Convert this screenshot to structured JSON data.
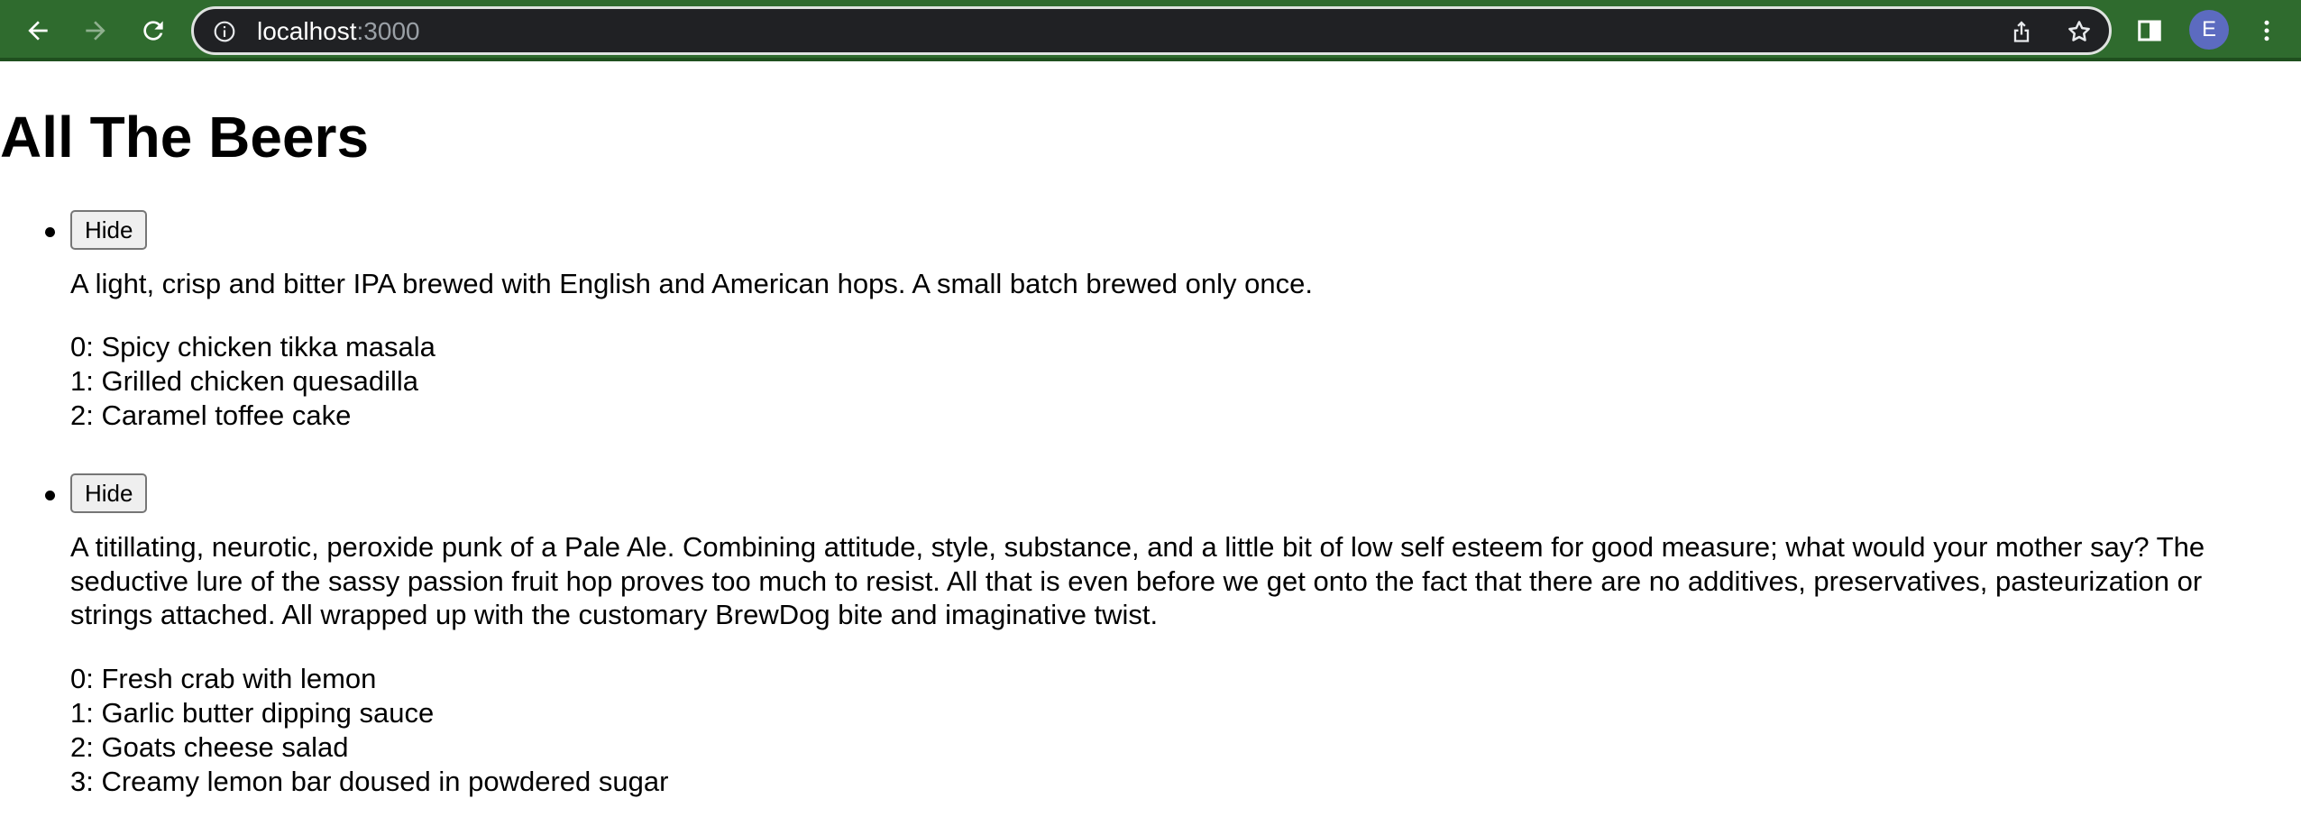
{
  "browser": {
    "url_host": "localhost",
    "url_port": ":3000",
    "profile_initial": "E"
  },
  "page": {
    "title": "All The Beers",
    "beers": [
      {
        "button_label": "Hide",
        "description": "A light, crisp and bitter IPA brewed with English and American hops. A small batch brewed only once.",
        "food_pairing": [
          "0: Spicy chicken tikka masala",
          "1: Grilled chicken quesadilla",
          "2: Caramel toffee cake"
        ]
      },
      {
        "button_label": "Hide",
        "description": "A titillating, neurotic, peroxide punk of a Pale Ale. Combining attitude, style, substance, and a little bit of low self esteem for good measure; what would your mother say? The seductive lure of the sassy passion fruit hop proves too much to resist. All that is even before we get onto the fact that there are no additives, preservatives, pasteurization or strings attached. All wrapped up with the customary BrewDog bite and imaginative twist.",
        "food_pairing": [
          "0: Fresh crab with lemon",
          "1: Garlic butter dipping sauce",
          "2: Goats cheese salad",
          "3: Creamy lemon bar doused in powdered sugar"
        ]
      }
    ]
  },
  "colors": {
    "toolbar": "#2f6b2e",
    "omnibox": "#202124",
    "avatar": "#5c6bc0"
  }
}
